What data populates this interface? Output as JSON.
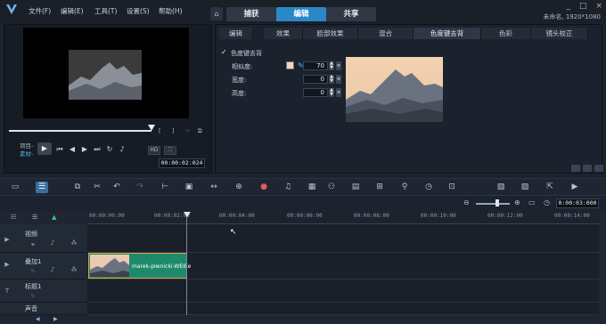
{
  "app": {
    "menu": [
      "文件(F)",
      "编辑(E)",
      "工具(T)",
      "设置(S)",
      "帮助(H)"
    ],
    "mode_tabs": [
      {
        "label": "捕获",
        "active": false
      },
      {
        "label": "编辑",
        "active": true
      },
      {
        "label": "共享",
        "active": false
      }
    ],
    "window_buttons": [
      "_",
      "□",
      "×"
    ],
    "project_info": "未命名, 1920*1080"
  },
  "preview": {
    "mode_project": "项目-",
    "mode_clip": "素材-",
    "bracket_in": "[",
    "bracket_out": "]",
    "timecode": "00:00:02:024",
    "hd_label": "HD"
  },
  "options": {
    "tabs": [
      {
        "label": "编辑",
        "active": false
      },
      {
        "label": "效果",
        "active": false
      },
      {
        "label": "脸部效果",
        "active": false
      },
      {
        "label": "混合",
        "active": false
      },
      {
        "label": "色度键去背",
        "active": true
      },
      {
        "label": "色彩",
        "active": false
      },
      {
        "label": "镜头校正",
        "active": false
      }
    ],
    "checkbox_label": "色度键去背",
    "checkbox_checked": true,
    "key_color": "#f4d6b8",
    "fields": [
      {
        "label": "相似度:",
        "value": "70"
      },
      {
        "label": "宽度:",
        "value": "0"
      },
      {
        "label": "高度:",
        "value": "0"
      }
    ]
  },
  "toolbar": {
    "icons": [
      "storyboard-view-icon",
      "timeline-view-icon",
      "copy-icon",
      "tools-icon",
      "undo-icon",
      "redo-icon",
      "split-icon",
      "screen-capture-icon",
      "fit-icon",
      "transform-icon",
      "color-icon",
      "audio-mixer-icon",
      "multi-camera-icon",
      "motion-icon",
      "subtitle-icon",
      "grid-icon",
      "mask-icon",
      "speed-icon",
      "stabilize-icon"
    ]
  },
  "timeline": {
    "duration": "0:00:03:000",
    "ruler": [
      "00:00:00:00",
      "00:00:02:00",
      "00:00:04:00",
      "00:00:06:00",
      "00:00:08:00",
      "00:00:10:00",
      "00:00:12:00",
      "00:00:14:00"
    ],
    "tracks": [
      {
        "name": "视频"
      },
      {
        "name": "叠加1"
      },
      {
        "name": "标题1"
      },
      {
        "name": "声音"
      }
    ],
    "clip_name": "marek-piwnicki-WEIEe"
  }
}
